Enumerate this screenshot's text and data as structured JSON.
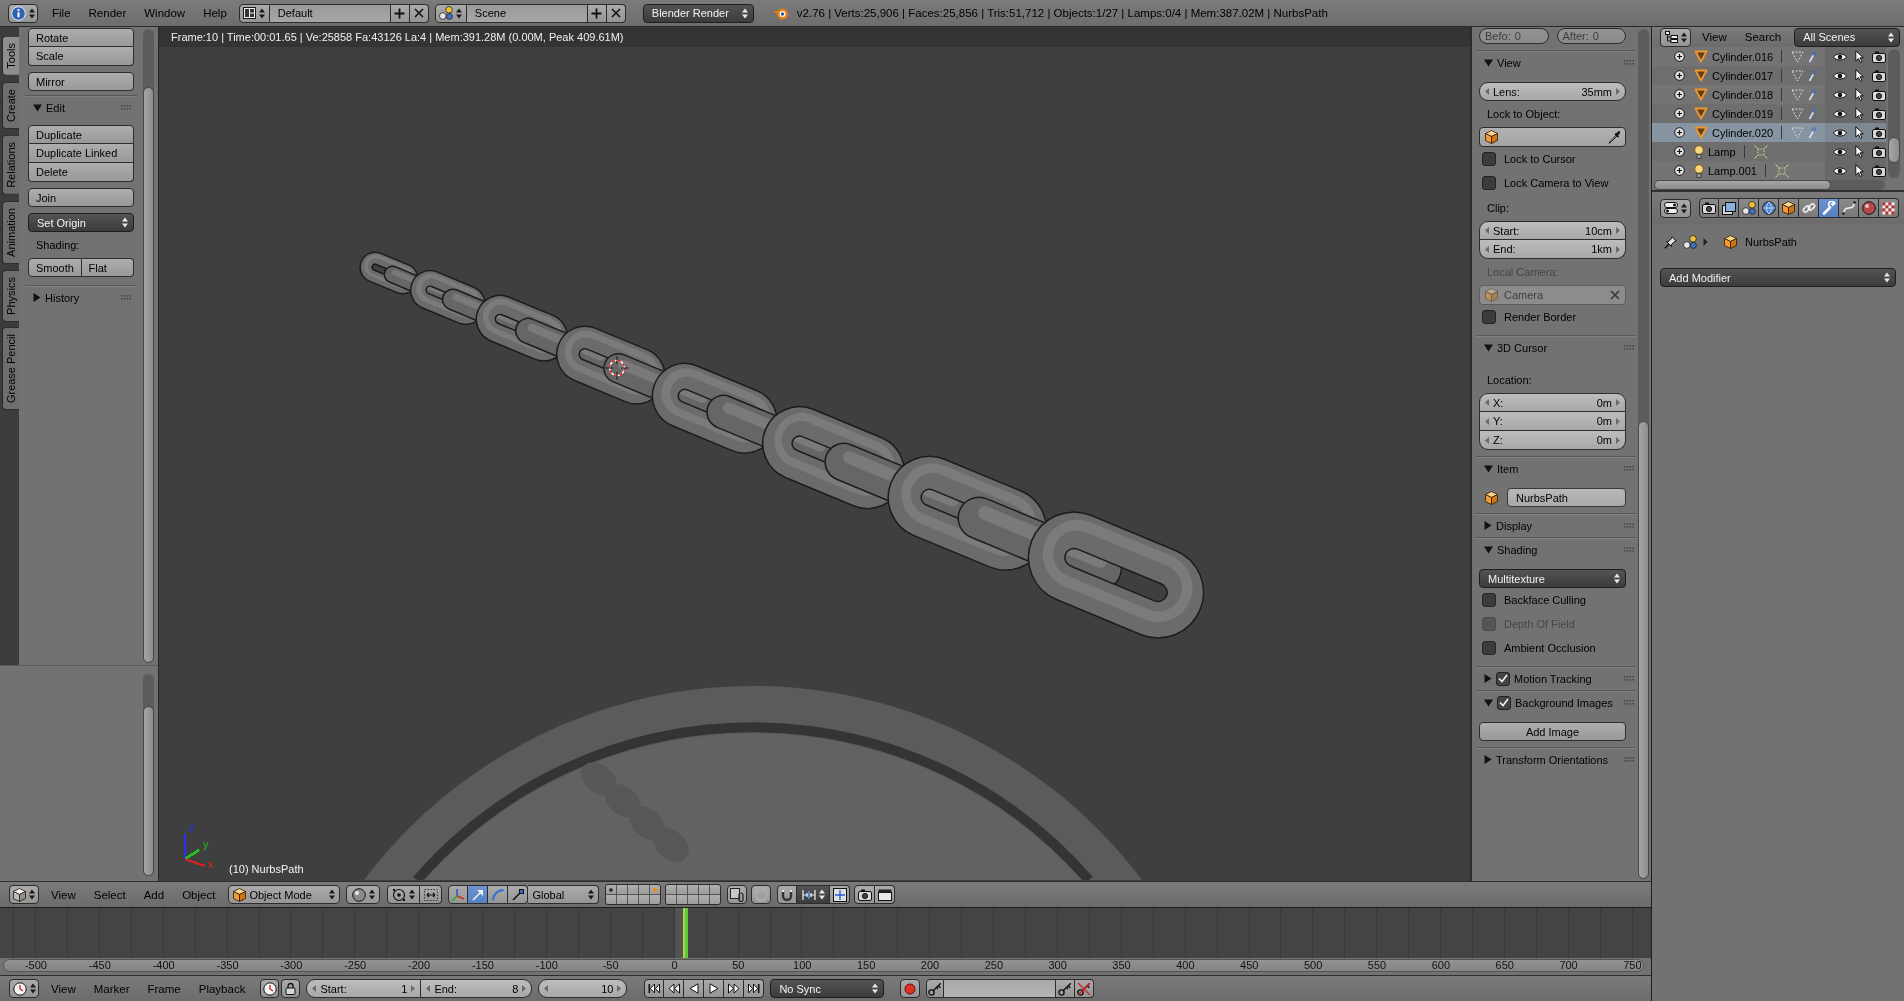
{
  "top_bar": {
    "menus": [
      "File",
      "Render",
      "Window",
      "Help"
    ],
    "screen": "Default",
    "scene": "Scene",
    "engine": "Blender Render",
    "stats": "v2.76 | Verts:25,906 | Faces:25,856 | Tris:51,712 | Objects:1/27 | Lamps:0/4 | Mem:387.02M | NurbsPath"
  },
  "tool_tabs": [
    {
      "label": "Tools",
      "selected": true
    },
    {
      "label": "Create",
      "selected": false
    },
    {
      "label": "Relations",
      "selected": false
    },
    {
      "label": "Animation",
      "selected": false
    },
    {
      "label": "Physics",
      "selected": false
    },
    {
      "label": "Grease Pencil",
      "selected": false
    }
  ],
  "tool_shelf": {
    "panels": [
      {
        "rows": [
          {
            "kind": "group",
            "buttons": [
              "Rotate",
              "Scale"
            ]
          },
          {
            "kind": "button",
            "label": "Mirror"
          }
        ]
      },
      {
        "label": "Edit",
        "expanded": true,
        "rows": [
          {
            "kind": "group",
            "buttons": [
              "Duplicate",
              "Duplicate Linked",
              "Delete"
            ]
          },
          {
            "kind": "button",
            "label": "Join"
          },
          {
            "kind": "dropdown",
            "label": "Set Origin"
          },
          {
            "kind": "label",
            "label": "Shading:"
          },
          {
            "kind": "row",
            "buttons": [
              "Smooth",
              "Flat"
            ]
          }
        ]
      },
      {
        "label": "History",
        "expanded": false
      }
    ]
  },
  "viewport": {
    "info": "Frame:10 | Time:00:01.65 | Ve:25858 Fa:43126 La:4 | Mem:391.28M (0.00M, Peak 409.61M)",
    "axes": [
      {
        "label": "z",
        "color": "#2030ff"
      },
      {
        "label": "y",
        "color": "#20c020"
      },
      {
        "label": "x",
        "color": "#e02020"
      }
    ],
    "object_label": "(10) NurbsPath"
  },
  "properties_region": {
    "history": [
      {
        "label": "Befo:",
        "value": "0",
        "disabled": true
      },
      {
        "label": "After:",
        "value": "0",
        "disabled": true
      }
    ],
    "panels": [
      {
        "label": "View",
        "expanded": true,
        "rows": [
          {
            "kind": "number",
            "label": "Lens:",
            "value": "35mm"
          },
          {
            "kind": "label",
            "label": "Lock to Object:",
            "disabled": false
          },
          {
            "kind": "object_field",
            "disabled": false,
            "eyedropper": true
          },
          {
            "kind": "checkbox",
            "label": "Lock to Cursor",
            "checked": false,
            "disabled": false
          },
          {
            "kind": "checkbox",
            "label": "Lock Camera to View",
            "checked": false,
            "disabled": false
          },
          {
            "kind": "label",
            "label": "Clip:",
            "disabled": false
          },
          {
            "kind": "numbers",
            "fields": [
              {
                "label": "Start:",
                "value": "10cm"
              },
              {
                "label": "End:",
                "value": "1km"
              }
            ]
          },
          {
            "kind": "label",
            "label": "Local Camera:",
            "disabled": true
          },
          {
            "kind": "object_field",
            "value": "Camera",
            "disabled": true,
            "clear": true
          },
          {
            "kind": "checkbox",
            "label": "Render Border",
            "checked": false,
            "disabled": false
          }
        ]
      },
      {
        "label": "3D Cursor",
        "expanded": true,
        "rows": [
          {
            "kind": "label",
            "label": "Location:",
            "disabled": false
          },
          {
            "kind": "numbers",
            "fields": [
              {
                "label": "X:",
                "value": "0m"
              },
              {
                "label": "Y:",
                "value": "0m"
              },
              {
                "label": "Z:",
                "value": "0m"
              }
            ]
          }
        ]
      },
      {
        "label": "Item",
        "expanded": true,
        "rows": [
          {
            "kind": "name_field",
            "value": "NurbsPath"
          }
        ]
      },
      {
        "label": "Display",
        "expanded": false
      },
      {
        "label": "Shading",
        "expanded": true,
        "rows": [
          {
            "kind": "dropdown",
            "value": "Multitexture"
          },
          {
            "kind": "checkbox",
            "label": "Backface Culling",
            "checked": false,
            "disabled": false
          },
          {
            "kind": "checkbox",
            "label": "Depth Of Field",
            "checked": false,
            "disabled": true
          },
          {
            "kind": "checkbox",
            "label": "Ambient Occlusion",
            "checked": false,
            "disabled": false
          }
        ]
      },
      {
        "label": "Motion Tracking",
        "expanded": false,
        "checked": true
      },
      {
        "label": "Background Images",
        "expanded": true,
        "checked": true,
        "rows": [
          {
            "kind": "button",
            "label": "Add Image"
          }
        ]
      },
      {
        "label": "Transform Orientations",
        "expanded": false
      }
    ]
  },
  "outliner": {
    "menus": [
      "View",
      "Search"
    ],
    "filter": "All Scenes",
    "rows": [
      {
        "kind": "mesh",
        "name": "Cylinder.016",
        "selected": false
      },
      {
        "kind": "mesh",
        "name": "Cylinder.017",
        "selected": false
      },
      {
        "kind": "mesh",
        "name": "Cylinder.018",
        "selected": false
      },
      {
        "kind": "mesh",
        "name": "Cylinder.019",
        "selected": false
      },
      {
        "kind": "mesh",
        "name": "Cylinder.020",
        "selected": true
      },
      {
        "kind": "lamp",
        "name": "Lamp",
        "selected": false
      },
      {
        "kind": "lamp",
        "name": "Lamp.001",
        "selected": false
      }
    ]
  },
  "properties_editor": {
    "tabs": [
      {
        "kind": "render",
        "selected": false
      },
      {
        "kind": "layers",
        "selected": false
      },
      {
        "kind": "scene",
        "selected": false
      },
      {
        "kind": "world",
        "selected": false
      },
      {
        "kind": "object",
        "selected": false
      },
      {
        "kind": "constraints",
        "selected": false
      },
      {
        "kind": "modifiers",
        "selected": true
      },
      {
        "kind": "data",
        "selected": false
      },
      {
        "kind": "material",
        "selected": false
      },
      {
        "kind": "texture",
        "selected": false
      }
    ],
    "context": "NurbsPath",
    "add_modifier": "Add Modifier"
  },
  "view3d_header": {
    "menus": [
      "View",
      "Select",
      "Add",
      "Object"
    ],
    "mode": "Object Mode",
    "manipulators": [
      {
        "kind": "axes",
        "selected": false
      },
      {
        "kind": "translate",
        "selected": true
      },
      {
        "kind": "rotate",
        "selected": false
      },
      {
        "kind": "scale",
        "selected": false
      }
    ],
    "orientation": "Global",
    "layers": [
      {
        "kind": "objects"
      },
      {
        "kind": "empty"
      },
      {
        "kind": "empty"
      },
      {
        "kind": "empty"
      },
      {
        "kind": "active"
      },
      {
        "kind": "empty"
      },
      {
        "kind": "empty"
      },
      {
        "kind": "empty"
      },
      {
        "kind": "empty"
      },
      {
        "kind": "empty"
      },
      {
        "kind": "empty"
      },
      {
        "kind": "empty"
      },
      {
        "kind": "empty"
      },
      {
        "kind": "empty"
      },
      {
        "kind": "empty"
      },
      {
        "kind": "empty"
      },
      {
        "kind": "empty"
      },
      {
        "kind": "empty"
      },
      {
        "kind": "empty"
      },
      {
        "kind": "empty"
      }
    ]
  },
  "timeline": {
    "ruler": [
      "-500",
      "-450",
      "-400",
      "-350",
      "-300",
      "-250",
      "-200",
      "-150",
      "-100",
      "-50",
      "0",
      "50",
      "100",
      "150",
      "200",
      "250",
      "300",
      "350",
      "400",
      "450",
      "500",
      "550",
      "600",
      "650",
      "700",
      "750"
    ]
  },
  "timeline_header": {
    "menus": [
      "View",
      "Marker",
      "Frame",
      "Playback"
    ],
    "range": [
      {
        "label": "Start:",
        "value": "1"
      },
      {
        "label": "End:",
        "value": "8"
      }
    ],
    "current": "10",
    "sync": "No Sync"
  }
}
